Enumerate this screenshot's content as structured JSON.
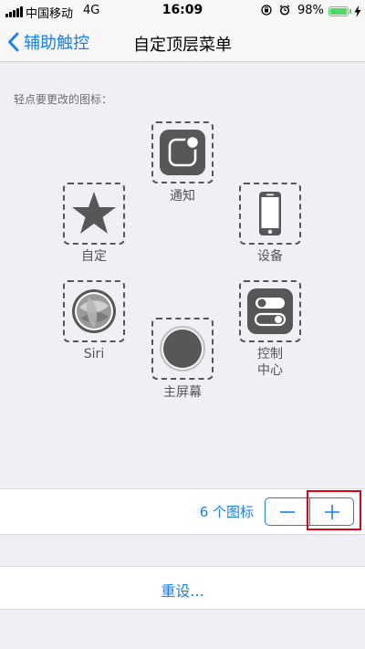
{
  "status_bar": {
    "carrier": "中国移动",
    "network": "4G",
    "time": "16:09",
    "battery_percent": "98%",
    "battery_level": 0.98,
    "icons": [
      "signal-bars-icon",
      "orientation-lock-icon",
      "alarm-icon",
      "battery-icon",
      "charging-bolt-icon"
    ]
  },
  "nav": {
    "back_label": "辅助触控",
    "title": "自定顶层菜单"
  },
  "hint": "轻点要更改的图标：",
  "menu_items": {
    "notification": "通知",
    "custom": "自定",
    "device": "设备",
    "siri": "Siri",
    "home": "主屏幕",
    "control_line1": "控制",
    "control_line2": "中心"
  },
  "icon_count": "6 个图标",
  "reset": "重设...",
  "colors": {
    "accent": "#147efb",
    "highlight_box": "#e3001b",
    "battery": "#4cd964",
    "icon_tile": "#575757"
  }
}
